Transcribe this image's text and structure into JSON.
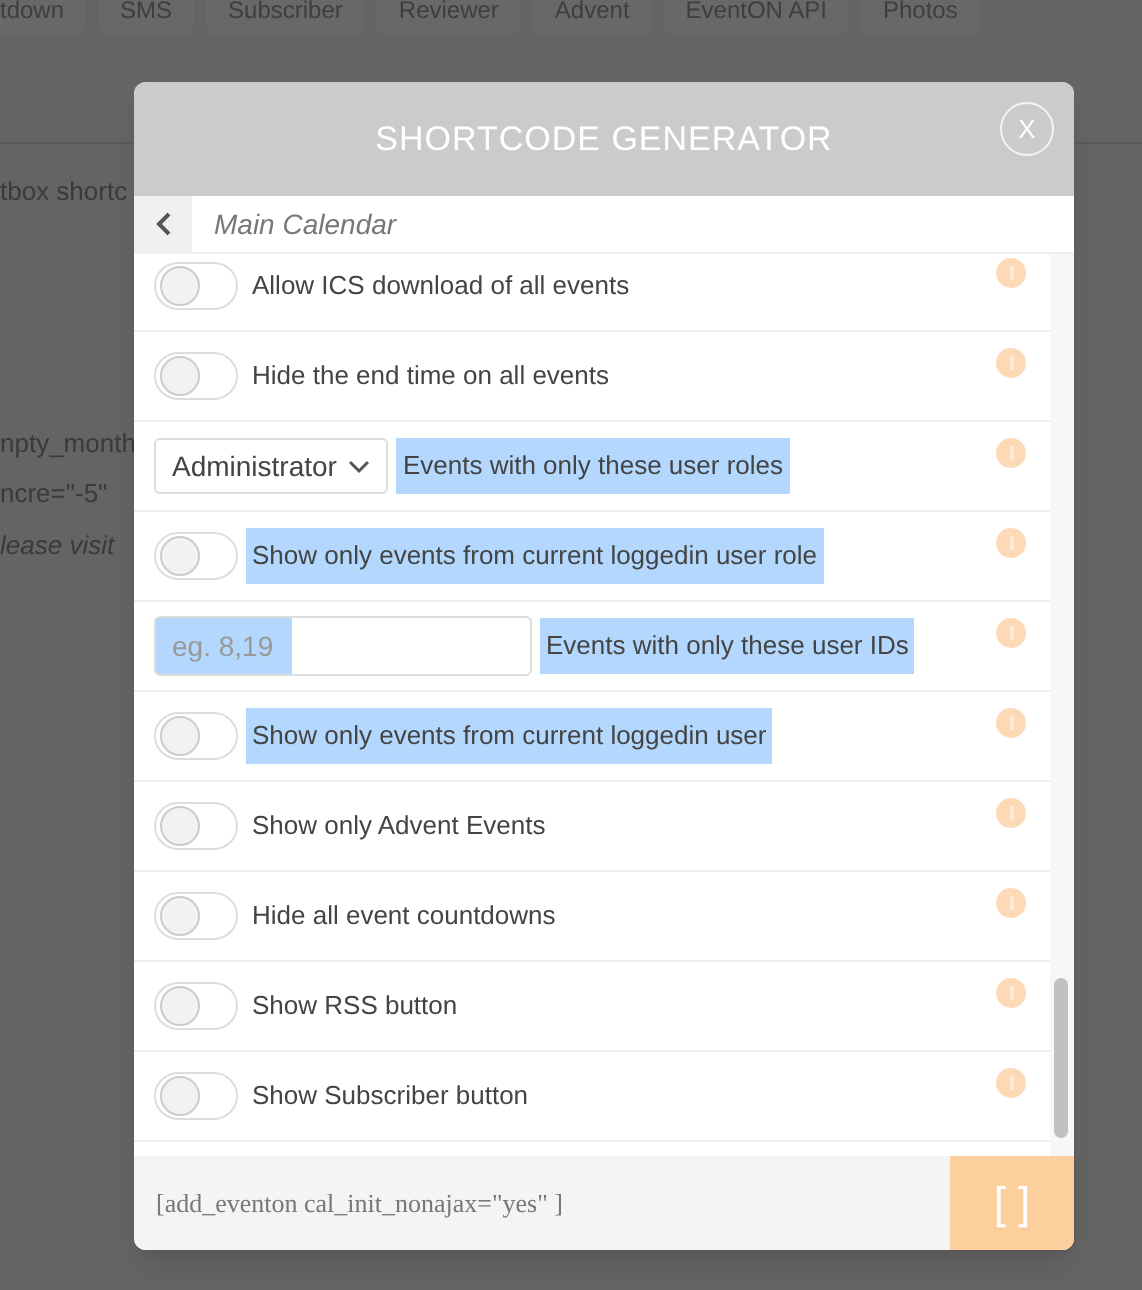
{
  "background": {
    "tabs": [
      "tdown",
      "SMS",
      "Subscriber",
      "Reviewer",
      "Advent",
      "EventON API",
      "Photos"
    ],
    "lines": [
      {
        "text": "tbox shortc",
        "italic": false
      },
      {
        "text": "npty_month",
        "italic": false
      },
      {
        "text": "ncre=\"-5\"",
        "italic": false
      },
      {
        "text": "lease visit",
        "italic": true
      }
    ]
  },
  "modal": {
    "title": "SHORTCODE GENERATOR",
    "close": "X",
    "breadcrumb": "Main Calendar",
    "rows": [
      {
        "kind": "toggle",
        "label": "Allow ICS download of all events",
        "on": false,
        "highlighted": false
      },
      {
        "kind": "toggle",
        "label": "Hide the end time on all events",
        "on": false,
        "highlighted": false
      },
      {
        "kind": "select",
        "value": "Administrator",
        "label": "Events with only these user roles",
        "highlighted": true
      },
      {
        "kind": "toggle",
        "label": "Show only events from current loggedin user role",
        "on": false,
        "highlighted": true
      },
      {
        "kind": "input",
        "placeholder": "eg. 8,19",
        "label": "Events with only these user IDs",
        "highlighted": true
      },
      {
        "kind": "toggle",
        "label": "Show only events from current loggedin user",
        "on": false,
        "highlighted": true
      },
      {
        "kind": "toggle",
        "label": "Show only Advent Events",
        "on": false,
        "highlighted": false
      },
      {
        "kind": "toggle",
        "label": "Hide all event countdowns",
        "on": false,
        "highlighted": false
      },
      {
        "kind": "toggle",
        "label": "Show RSS button",
        "on": false,
        "highlighted": false
      },
      {
        "kind": "toggle",
        "label": "Show Subscriber button",
        "on": false,
        "highlighted": false
      }
    ],
    "shortcode": "[add_eventon cal_init_nonajax=\"yes\" ]",
    "copy_button": "[ ]"
  }
}
